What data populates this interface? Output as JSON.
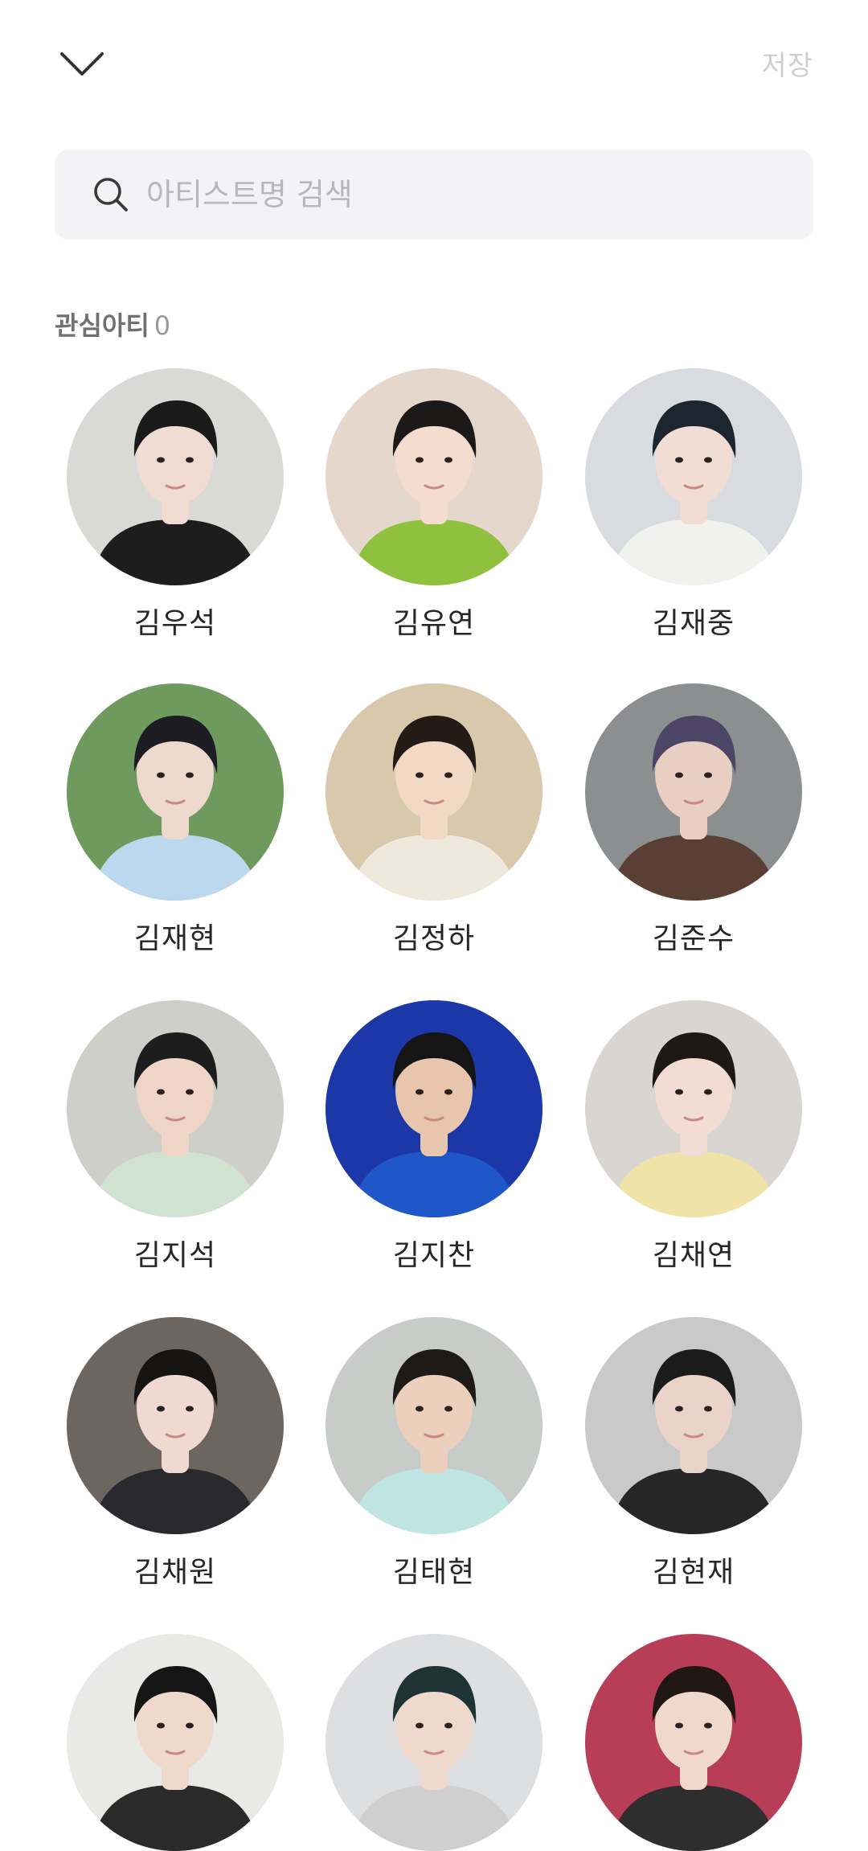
{
  "header": {
    "save_label": "저장"
  },
  "search": {
    "placeholder": "아티스트명 검색"
  },
  "favorites": {
    "title": "관심아티",
    "count": "0"
  },
  "artists": [
    {
      "name": "김우석",
      "bg": "#d9d9d6",
      "skin": "#f0dcd2",
      "hair": "#1a1a1a",
      "outfit": "#1d1d1d"
    },
    {
      "name": "김유연",
      "bg": "#e6d7cc",
      "skin": "#f4dccf",
      "hair": "#1c1a19",
      "outfit": "#8fc13f"
    },
    {
      "name": "김재중",
      "bg": "#d8dbe0",
      "skin": "#f1ddd3",
      "hair": "#1d2630",
      "outfit": "#f1f1ee"
    },
    {
      "name": "김재현",
      "bg": "#6f9a5d",
      "skin": "#eed9cf",
      "hair": "#1c1c22",
      "outfit": "#bcd8ee"
    },
    {
      "name": "김정하",
      "bg": "#d8c8ac",
      "skin": "#f1d9c5",
      "hair": "#241b17",
      "outfit": "#efe8dc"
    },
    {
      "name": "김준수",
      "bg": "#8c8f90",
      "skin": "#e8cfc1",
      "hair": "#4c4566",
      "outfit": "#5a4034"
    },
    {
      "name": "김지석",
      "bg": "#cfcfc9",
      "skin": "#efd5c6",
      "hair": "#1d1d1d",
      "outfit": "#cfe3d0"
    },
    {
      "name": "김지찬",
      "bg": "#1b37a8",
      "skin": "#e7c6ad",
      "hair": "#151515",
      "outfit": "#1f57c8"
    },
    {
      "name": "김채연",
      "bg": "#d9d6d2",
      "skin": "#f2dcd3",
      "hair": "#1d1815",
      "outfit": "#efe3a8"
    },
    {
      "name": "김채원",
      "bg": "#6d6660",
      "skin": "#f0d9d1",
      "hair": "#161313",
      "outfit": "#2a2a2e"
    },
    {
      "name": "김태현",
      "bg": "#c8ccc9",
      "skin": "#eccfbd",
      "hair": "#1d1a18",
      "outfit": "#bfe5e2"
    },
    {
      "name": "김현재",
      "bg": "#c9c9c9",
      "skin": "#ead4c9",
      "hair": "#1b1b1b",
      "outfit": "#262626"
    },
    {
      "name": "",
      "bg": "#e9e9e6",
      "skin": "#efd8cc",
      "hair": "#151515",
      "outfit": "#2a2a2a"
    },
    {
      "name": "",
      "bg": "#dedfe0",
      "skin": "#efd8cc",
      "hair": "#1f3334",
      "outfit": "#cfcfcf"
    },
    {
      "name": "",
      "bg": "#b73e56",
      "skin": "#f0d8cc",
      "hair": "#201614",
      "outfit": "#2e2e2e"
    }
  ]
}
